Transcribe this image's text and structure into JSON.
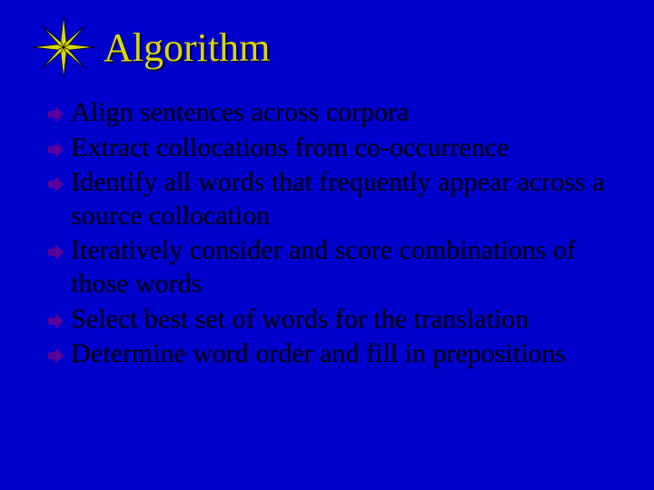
{
  "title": "Algorithm",
  "bullets": [
    {
      "text": "Align sentences across corpora"
    },
    {
      "text": "Extract collocations from co-occurrence"
    },
    {
      "text": "Identify all words that frequently appear across a source collocation"
    },
    {
      "text": "Iteratively consider and score combinations of those words"
    },
    {
      "text": "Select best set of words for the translation"
    },
    {
      "text": "Determine word order and fill in prepositions"
    }
  ],
  "colors": {
    "background": "#0000cc",
    "title": "#d8d800",
    "bullet_fill": "#5a009a"
  }
}
